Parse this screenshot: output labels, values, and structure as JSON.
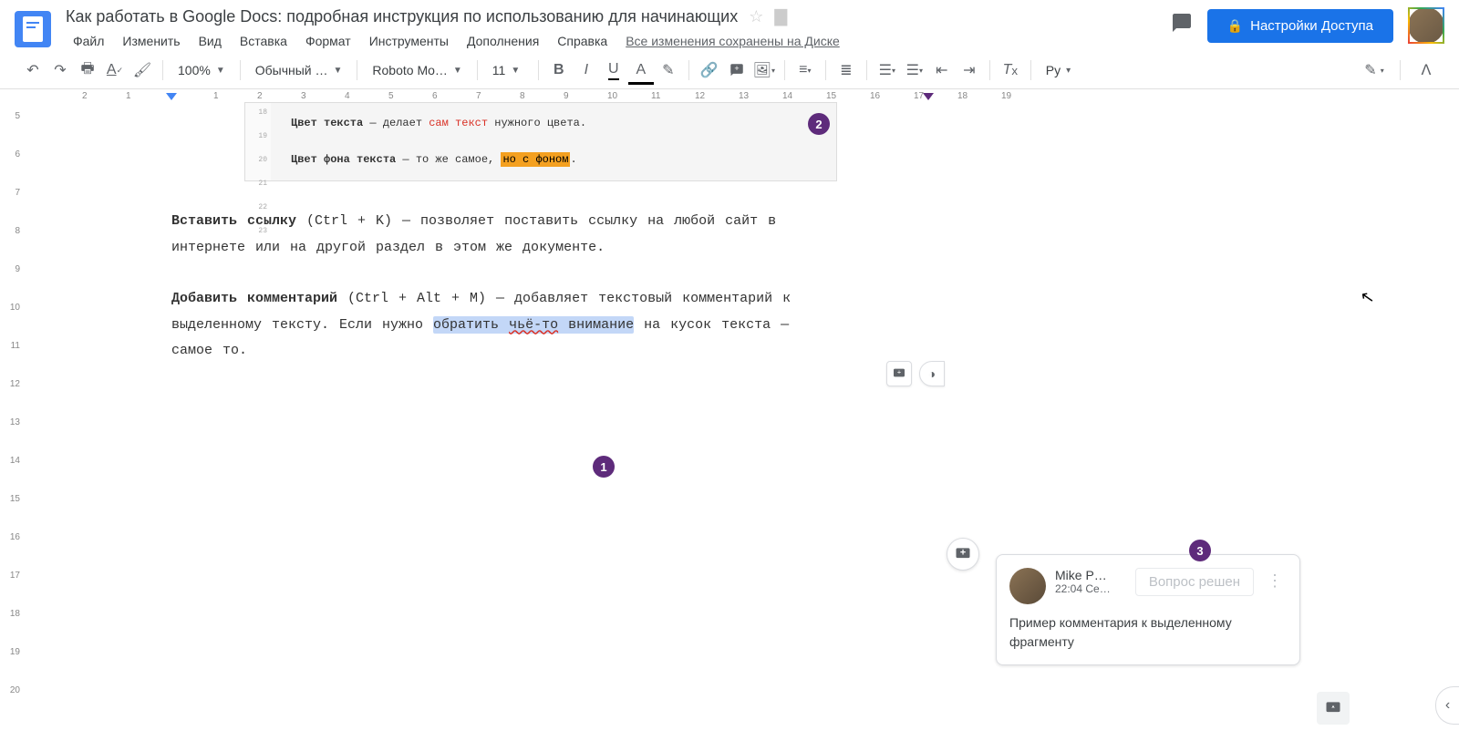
{
  "header": {
    "title": "Как работать в Google Docs: подробная инструкция по использованию для начинающих",
    "save_status": "Все изменения сохранены на Диске",
    "share_label": "Настройки Доступа"
  },
  "menubar": [
    "Файл",
    "Изменить",
    "Вид",
    "Вставка",
    "Формат",
    "Инструменты",
    "Дополнения",
    "Справка"
  ],
  "toolbar": {
    "zoom": "100%",
    "style": "Обычный …",
    "font": "Roboto Mo…",
    "size": "11",
    "lang": "Ру"
  },
  "ruler_h": [
    "2",
    "1",
    "",
    "1",
    "2",
    "3",
    "4",
    "5",
    "6",
    "7",
    "8",
    "9",
    "10",
    "11",
    "12",
    "13",
    "14",
    "15",
    "16",
    "17",
    "18",
    "19"
  ],
  "ruler_v": [
    "5",
    "6",
    "7",
    "8",
    "9",
    "10",
    "11",
    "12",
    "13",
    "14",
    "15",
    "16",
    "17",
    "18",
    "19",
    "20"
  ],
  "nested": {
    "l1_b": "Цвет текста",
    "l1_mid": " — делает ",
    "l1_red": "сам текст",
    "l1_end": " нужного цвета.",
    "l2_b": "Цвет фона текста",
    "l2_mid": " — то же самое, ",
    "l2_hl": "но с фоном",
    "l2_end": ".",
    "vmarks": [
      "18",
      "19",
      "20",
      "21",
      "22",
      "23"
    ]
  },
  "para1": {
    "b": "Вставить ссылку",
    "rest": " (Ctrl + K) — позволяет поставить ссылку на любой сайт в интернете или на другой раздел в этом же документе."
  },
  "para2": {
    "b": "Добавить комментарий",
    "p1": " (Ctrl + Alt + M) — добавляет текстовый комментарий к выделенному тексту. Если нужно ",
    "sel_a": "обратить ",
    "sel_err": "чьё-то",
    "sel_b": " внимание",
    "p2": " на кусок текста — самое то."
  },
  "comment": {
    "author": "Mike P…",
    "time": "22:04 Се…",
    "resolve": "Вопрос решен",
    "body": "Пример комментария к выделенному фрагменту"
  },
  "badges": {
    "b1": "1",
    "b2": "2",
    "b3": "3"
  }
}
